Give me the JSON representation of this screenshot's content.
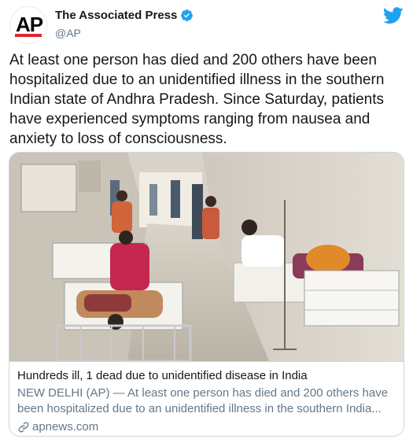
{
  "account": {
    "display_name": "The Associated Press",
    "handle": "@AP",
    "logo_text": "AP",
    "verified": true
  },
  "tweet": {
    "text": "At least one person has died and 200 others have been hospitalized due to an unidentified illness in the southern Indian state of Andhra Pradesh. Since Saturday, patients have experienced symptoms ranging from nausea and anxiety to loss of consciousness."
  },
  "card": {
    "title": "Hundreds ill, 1 dead due to unidentified disease in India",
    "description": "NEW DELHI (AP) — At least one person has died and 200 others have been hospitalized due to an unidentified illness in the southern India...",
    "domain": "apnews.com"
  },
  "icons": {
    "verified": "verified-badge-icon",
    "brand": "twitter-bird-icon",
    "link": "link-icon"
  },
  "colors": {
    "twitter_blue": "#1da1f2",
    "ap_red": "#e0252e",
    "secondary_text": "#657786",
    "border": "#ccd6dd"
  }
}
